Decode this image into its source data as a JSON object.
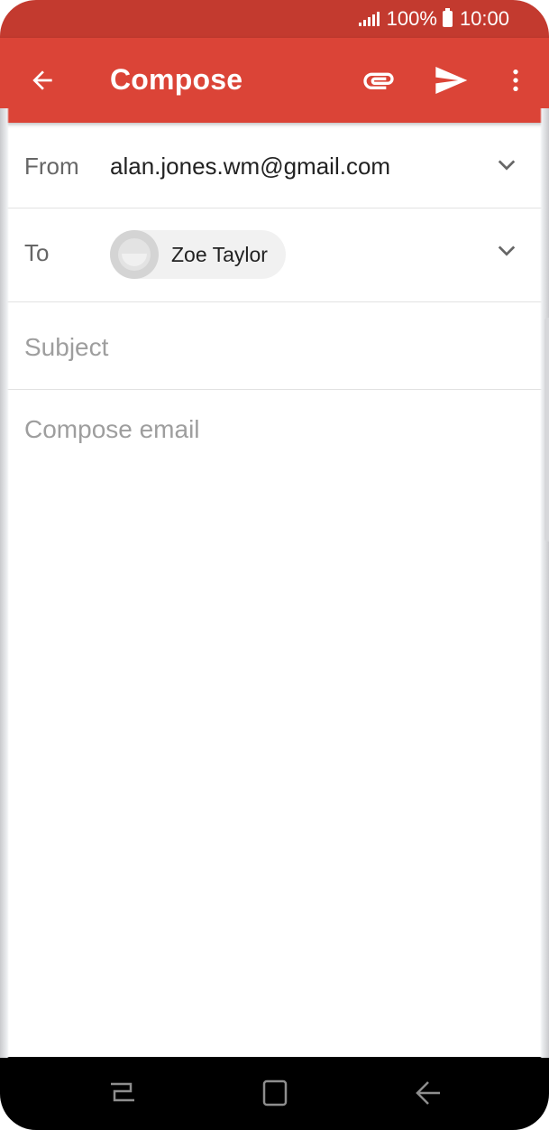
{
  "status_bar": {
    "battery_percent": "100%",
    "time": "10:00",
    "signal_icon": "signal-icon",
    "battery_icon": "battery-icon"
  },
  "app_bar": {
    "title": "Compose",
    "back_icon": "arrow-back-icon",
    "attach_icon": "paperclip-icon",
    "send_icon": "send-icon",
    "more_icon": "more-vertical-icon",
    "color": "#db4437",
    "status_color": "#c33a2f"
  },
  "form": {
    "from_label": "From",
    "from_value": "alan.jones.wm@gmail.com",
    "to_label": "To",
    "to_recipients": [
      {
        "name": "Zoe Taylor"
      }
    ],
    "subject_placeholder": "Subject",
    "body_placeholder": "Compose email"
  },
  "nav_bar": {
    "recent_icon": "recent-apps-icon",
    "home_icon": "home-icon",
    "back_icon": "back-icon"
  }
}
